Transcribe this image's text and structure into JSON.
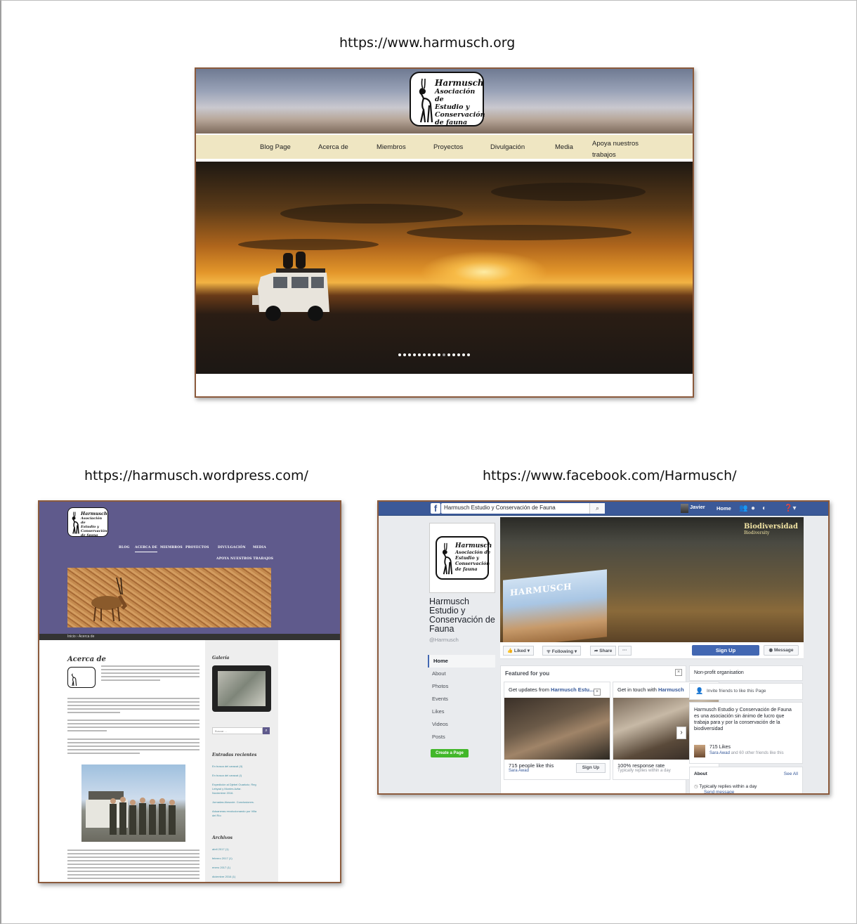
{
  "labels": {
    "main_url": "https://www.harmusch.org",
    "wordpress_url": "https://harmusch.wordpress.com/",
    "facebook_url": "https://www.facebook.com/Harmusch/"
  },
  "harmusch_org": {
    "logo_lines": [
      "Harmusch",
      "Asociación de",
      "Estudio y",
      "Conservación",
      "de fauna"
    ],
    "nav": [
      "Blog Page",
      "Acerca de",
      "Miembros",
      "Proyectos",
      "Divulgación",
      "Media",
      "Apoya nuestros",
      "trabajos"
    ],
    "slider_active_dot": 10
  },
  "wordpress": {
    "logo_lines": [
      "Harmusch",
      "Asociación de",
      "Estudio y",
      "Conservación",
      "de fauna"
    ],
    "nav": [
      "BLOG",
      "ACERCA DE",
      "MIEMBROS",
      "PROYECTOS",
      "DIVULGACIÓN",
      "MEDIA",
      "APOYA NUESTROS TRABAJOS"
    ],
    "breadcrumb": "Inicio › Acerca de",
    "title": "Acerca de",
    "sidebar": {
      "gallery_title": "Galería",
      "search_placeholder": "Buscar ...",
      "recent_title": "Entradas recientes",
      "recent": [
        "En busca del caracal (II)",
        "En busca del caracal (I)",
        "Expedición al Djebel Ouarkziz, Reg",
        "Lebyad y Montes Azfar.",
        "Noviembre 2016.",
        "Jornadas Alosocie. Conclusiones.",
        "Aduaneras revolucionando por Villa",
        "del Río"
      ],
      "archive_title": "Archivos",
      "archive": [
        "abril 2017 (1)",
        "febrero 2017 (1)",
        "enero 2017 (1)",
        "diciembre 2016 (1)"
      ]
    }
  },
  "facebook": {
    "search_value": "Harmusch Estudio y Conservación de Fauna",
    "user": "Javier",
    "home": "Home",
    "profile_logo_lines": [
      "Harmusch",
      "Asociación de",
      "Estudio y",
      "Conservación",
      "de fauna"
    ],
    "page_name": "Harmusch Estudio y Conservación de Fauna",
    "handle": "@Harmusch",
    "menu": [
      "Home",
      "About",
      "Photos",
      "Events",
      "Likes",
      "Videos",
      "Posts"
    ],
    "create_page": "Create a Page",
    "cover_title": "Biodiversidad",
    "cover_subtitle": "Biodiversity",
    "cover_box_text": "HARMUSCH",
    "actions": {
      "liked": "Liked ▾",
      "following": "Following ▾",
      "share": "Share",
      "more": "···",
      "signup": "Sign Up",
      "message": "Message"
    },
    "featured": {
      "title": "Featured for you",
      "card1_prefix": "Get updates from",
      "card1_name": "Harmusch Estu...",
      "card1_stat": "715 people like this",
      "card1_friend": "Sara Awad",
      "card1_friend_rest": "and 60 other fri...",
      "card1_button": "Sign Up",
      "card2_prefix": "Get in touch with",
      "card2_name": "Harmusch",
      "card2_stat": "100% response rate",
      "card2_sub": "Typically replies within a day"
    },
    "right": {
      "category": "Non-profit organisation",
      "invite": "Invite friends to like this Page",
      "description": "Harmusch Estudio y Conservación de Fauna es una asociación sin ánimo de lucro que trabaja para y por la conservación de la biodiversidad",
      "likes": "715 Likes",
      "likes_friend": "Sara Awad",
      "likes_rest": "and 60 other friends like this",
      "about_title": "About",
      "see_all": "See All",
      "replies": "Typically replies within a day",
      "send_message": "Send message"
    }
  }
}
